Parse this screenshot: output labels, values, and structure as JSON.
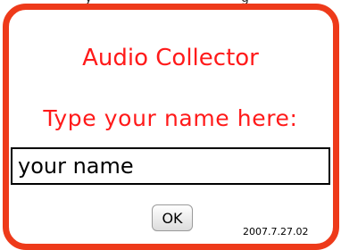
{
  "dialog": {
    "title": "Audio Collector",
    "prompt": "Type your name here:",
    "name_input": {
      "value": "your name"
    },
    "ok_label": "OK",
    "version": "2007.7.27.02",
    "accent_color": "#ee3a1a"
  }
}
